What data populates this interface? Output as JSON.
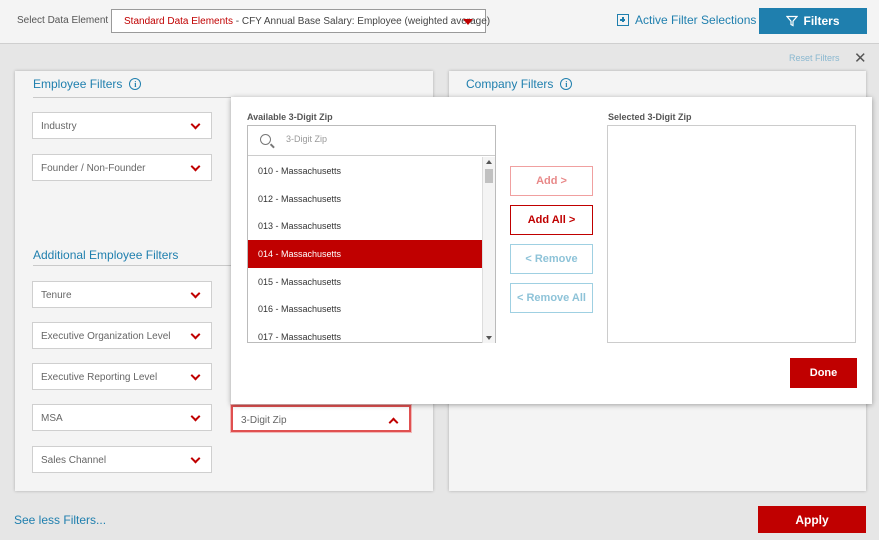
{
  "topbar": {
    "label": "Select Data Element",
    "data_element": {
      "prefix": "Standard Data Elements",
      "separator": " - ",
      "value": "CFY Annual Base Salary: Employee (weighted average)"
    },
    "active_filter_label": "Active Filter Selections",
    "filters_label": "Filters"
  },
  "reset_label": "Reset Filters",
  "employee_panel": {
    "title": "Employee Filters",
    "primary_dropdowns": [
      "Industry",
      "Founder / Non-Founder"
    ],
    "additional_title": "Additional Employee Filters",
    "additional_dropdowns": [
      "Tenure",
      "Executive Organization Level",
      "Executive Reporting Level",
      "MSA",
      "Sales Channel"
    ],
    "zip_dropdown": "3-Digit Zip"
  },
  "company_panel": {
    "title": "Company Filters"
  },
  "modal": {
    "available_label": "Available 3-Digit Zip",
    "selected_label": "Selected 3-Digit Zip",
    "search_placeholder": "3-Digit Zip",
    "items": [
      "010 - Massachusetts",
      "012 - Massachusetts",
      "013 - Massachusetts",
      "014 - Massachusetts",
      "015 - Massachusetts",
      "016 - Massachusetts",
      "017 - Massachusetts"
    ],
    "selected_item": "014 - Massachusetts",
    "add_label": "Add >",
    "add_all_label": "Add All  >",
    "remove_label": "<  Remove",
    "remove_all_label": "<  Remove All",
    "done_label": "Done"
  },
  "footer": {
    "see_less_label": "See less Filters...",
    "apply_label": "Apply"
  },
  "colors": {
    "brand_red": "#c00000",
    "accent_blue": "#1f7fae"
  }
}
